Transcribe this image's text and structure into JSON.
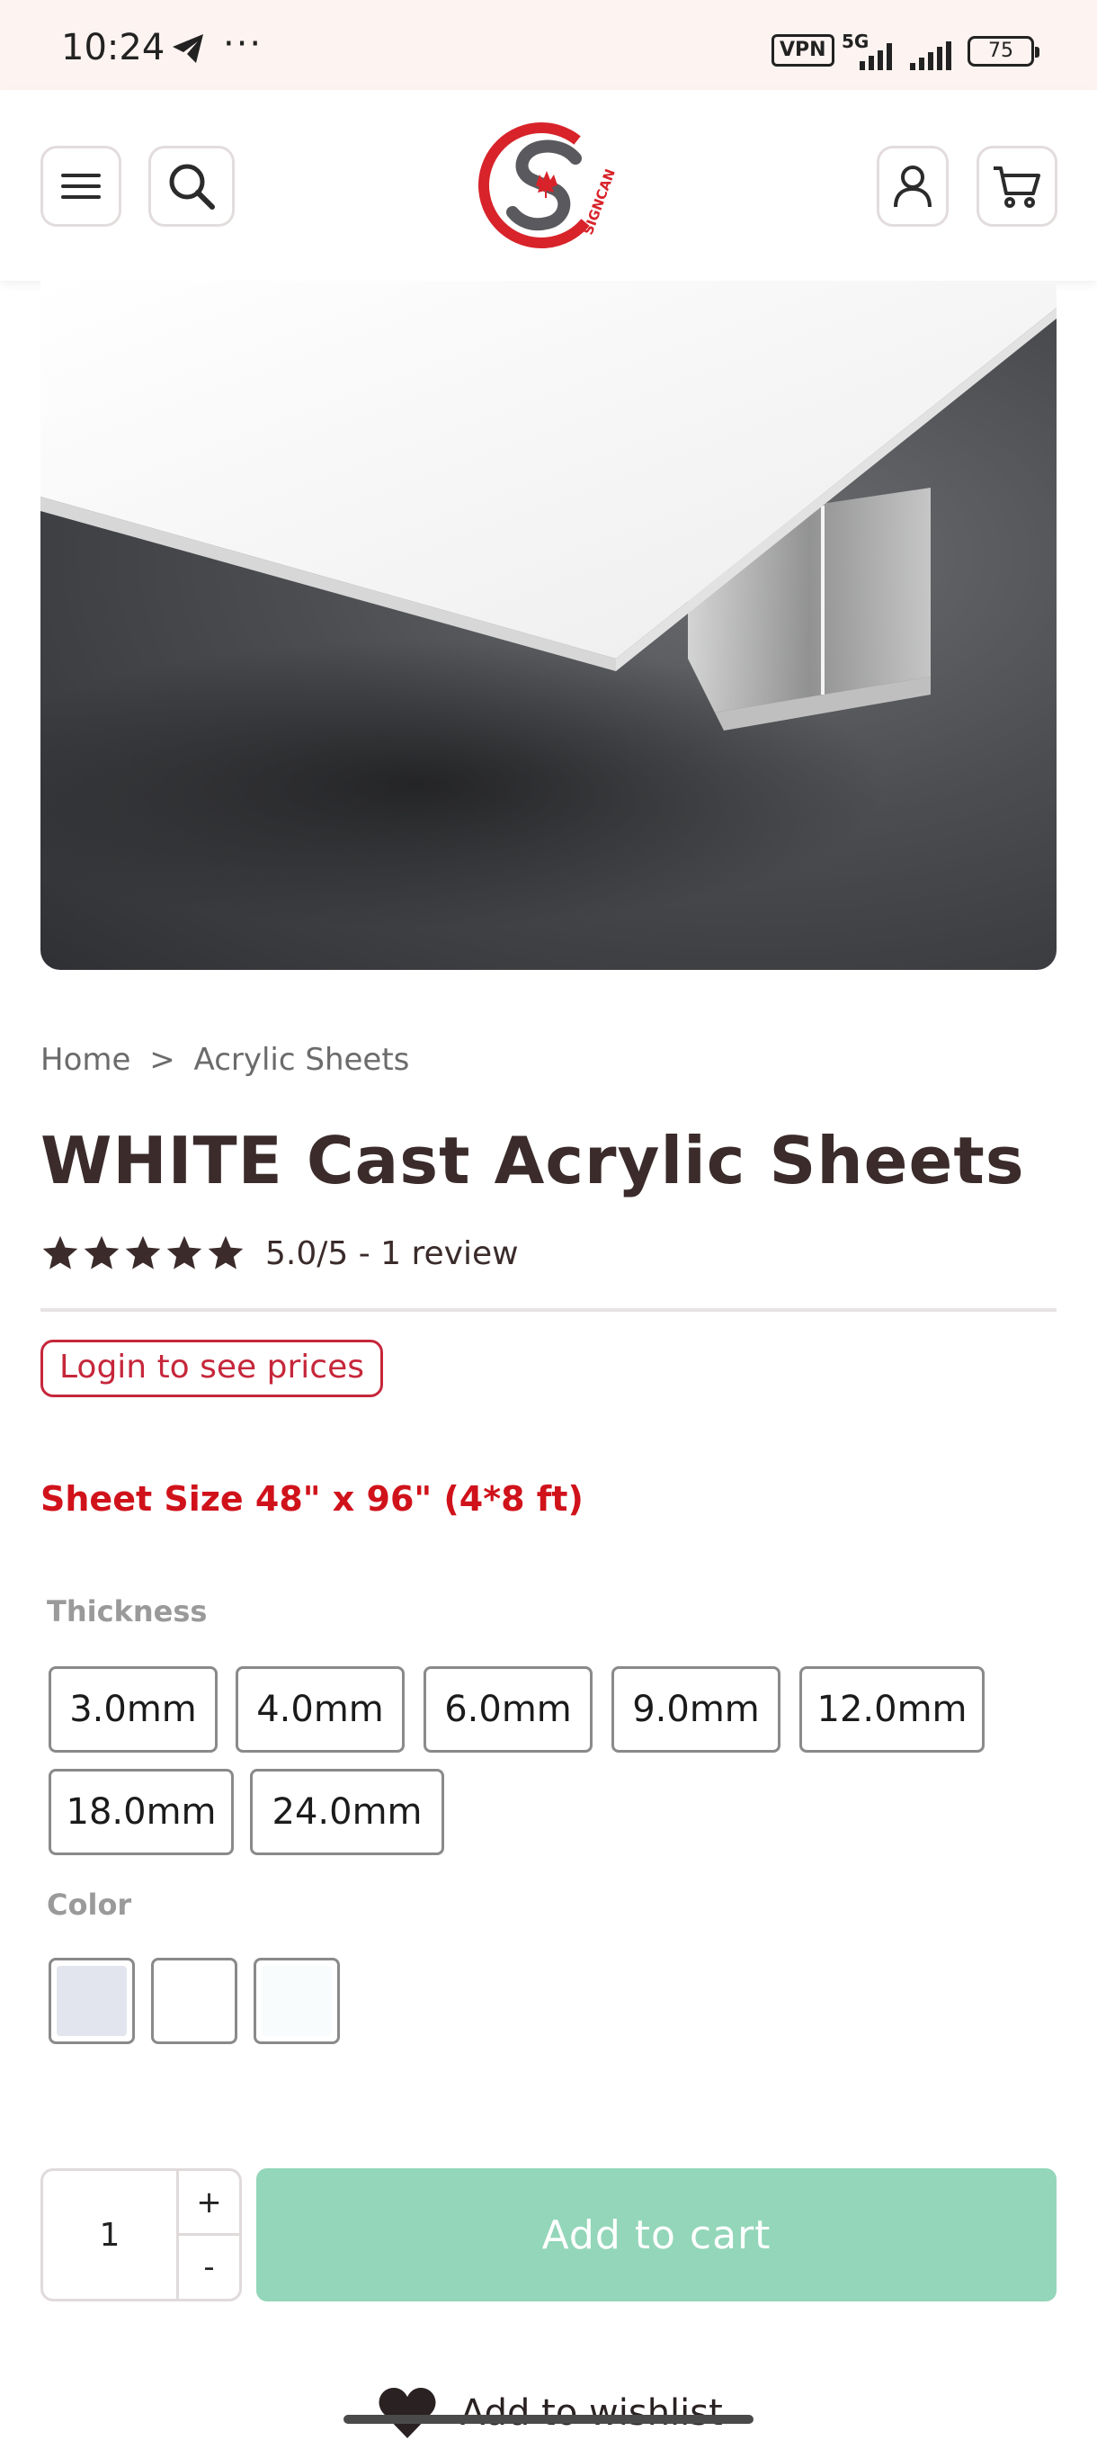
{
  "status_bar": {
    "time": "10:24",
    "dots": "···",
    "vpn": "VPN",
    "network": "5G",
    "battery": "75"
  },
  "header": {
    "menu_icon": "hamburger-icon",
    "search_icon": "search-icon",
    "logo_text": "SIGNCAN",
    "account_icon": "user-icon",
    "cart_icon": "cart-icon"
  },
  "breadcrumb": {
    "home": "Home",
    "separator": ">",
    "current": "Acrylic Sheets"
  },
  "product": {
    "title": "WHITE Cast Acrylic Sheets",
    "rating": 5.0,
    "rating_text": "5.0/5 - 1 review",
    "login_prices": "Login to see prices",
    "sheet_size": "Sheet Size 48\" x 96\" (4*8 ft)"
  },
  "thickness": {
    "label": "Thickness",
    "options": [
      "3.0mm",
      "4.0mm",
      "6.0mm",
      "9.0mm",
      "12.0mm",
      "18.0mm",
      "24.0mm"
    ]
  },
  "color": {
    "label": "Color",
    "swatches": [
      "#e3e5ee",
      "#ffffff",
      "#f8fcfc"
    ]
  },
  "cart": {
    "quantity": "1",
    "plus": "+",
    "minus": "-",
    "add_label": "Add to cart",
    "accent_color": "#93d6b9"
  },
  "wishlist": {
    "label": "Add to wishlist"
  }
}
